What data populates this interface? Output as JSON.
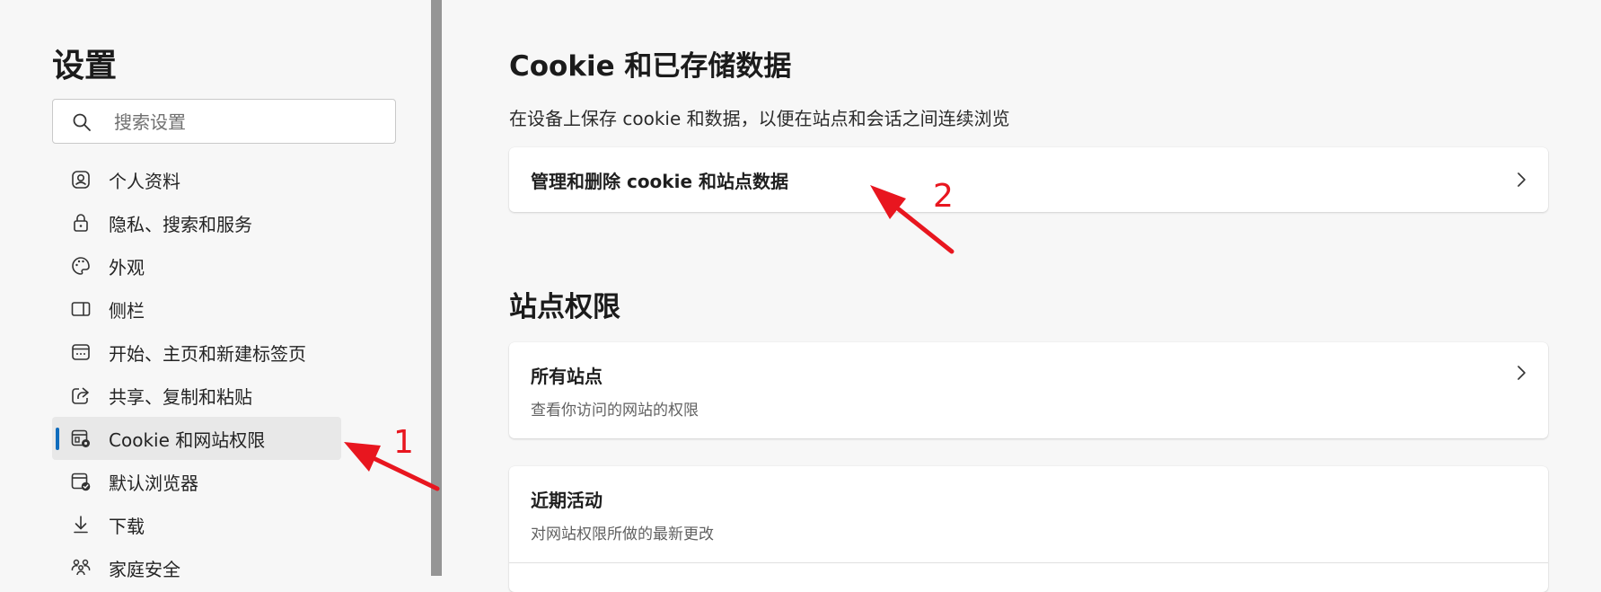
{
  "sidebar": {
    "title": "设置",
    "search": {
      "placeholder": "搜索设置",
      "value": ""
    },
    "items": [
      {
        "label": "个人资料",
        "icon": "profile-icon",
        "active": false
      },
      {
        "label": "隐私、搜索和服务",
        "icon": "lock-icon",
        "active": false
      },
      {
        "label": "外观",
        "icon": "palette-icon",
        "active": false
      },
      {
        "label": "侧栏",
        "icon": "sidebar-icon",
        "active": false
      },
      {
        "label": "开始、主页和新建标签页",
        "icon": "new-tab-icon",
        "active": false
      },
      {
        "label": "共享、复制和粘贴",
        "icon": "share-icon",
        "active": false
      },
      {
        "label": "Cookie 和网站权限",
        "icon": "cookie-settings-icon",
        "active": true
      },
      {
        "label": "默认浏览器",
        "icon": "default-browser-icon",
        "active": false
      },
      {
        "label": "下载",
        "icon": "download-icon",
        "active": false
      },
      {
        "label": "家庭安全",
        "icon": "family-icon",
        "active": false
      }
    ]
  },
  "main": {
    "cookies_section": {
      "heading": "Cookie 和已存储数据",
      "subtitle": "在设备上保存 cookie 和数据，以便在站点和会话之间连续浏览",
      "manage_row": {
        "title": "管理和删除 cookie 和站点数据"
      }
    },
    "permissions_section": {
      "heading": "站点权限",
      "all_sites": {
        "title": "所有站点",
        "desc": "查看你访问的网站的权限"
      },
      "recent_activity": {
        "title": "近期活动",
        "desc": "对网站权限所做的最新更改"
      }
    }
  },
  "annotations": {
    "step1": "1",
    "step2": "2",
    "color": "#e8161f"
  },
  "colors": {
    "accent": "#0f6cbd",
    "background": "#f7f7f7",
    "card": "#ffffff"
  }
}
